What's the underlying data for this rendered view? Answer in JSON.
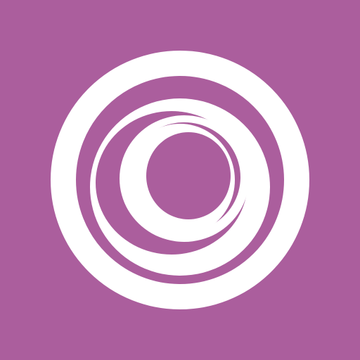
{
  "icon": {
    "name": "concentric-rings-logo",
    "background_color": "#AB5E9D",
    "foreground_color": "#FFFFFF"
  }
}
